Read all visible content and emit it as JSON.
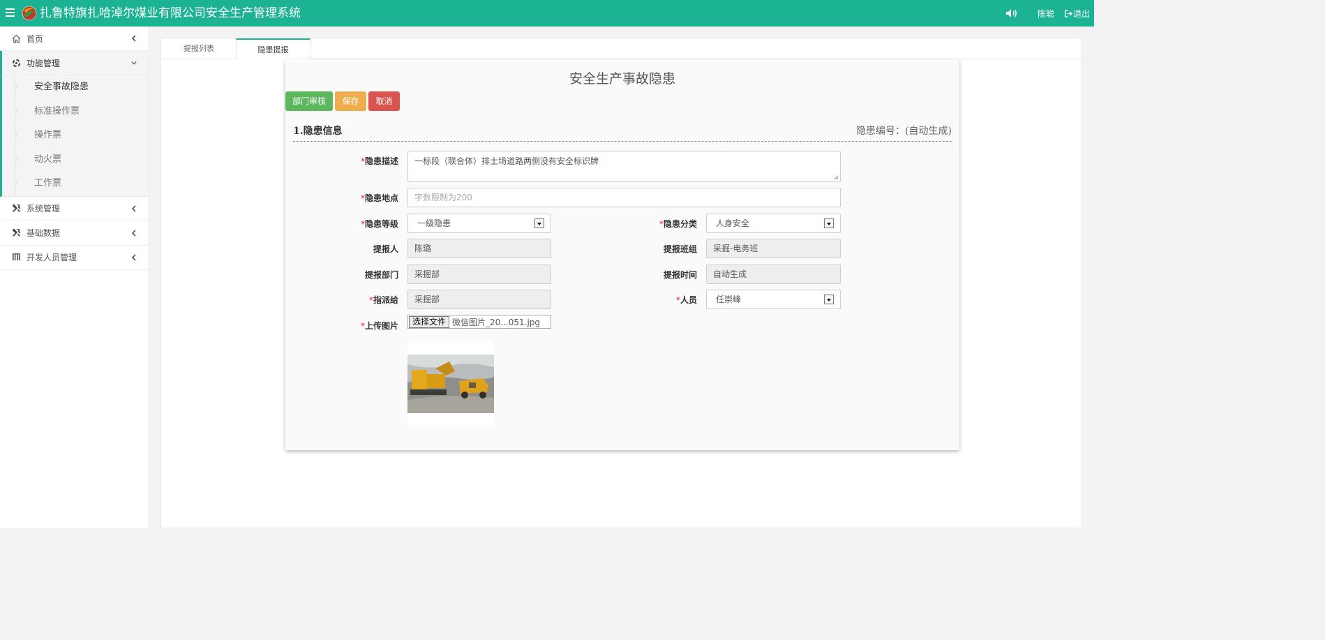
{
  "header": {
    "title": "扎鲁特旗扎哈淖尔煤业有限公司安全生产管理系统",
    "user_name": "陈聪",
    "logout_label": "退出",
    "bg_color": "#1bb394"
  },
  "sidebar": {
    "items": [
      {
        "label": "首页",
        "icon": "home-icon"
      },
      {
        "label": "功能管理",
        "icon": "settings-icon"
      },
      {
        "label": "系统管理",
        "icon": "tools-icon"
      },
      {
        "label": "基础数据",
        "icon": "tools-icon"
      },
      {
        "label": "开发人员管理",
        "icon": "bars-icon"
      }
    ],
    "submenu": [
      {
        "label": "安全事故隐患"
      },
      {
        "label": "标准操作票"
      },
      {
        "label": "操作票"
      },
      {
        "label": "动火票"
      },
      {
        "label": "工作票"
      }
    ]
  },
  "tabs": [
    {
      "label": "提报列表"
    },
    {
      "label": "隐患提报"
    }
  ],
  "form": {
    "title": "安全生产事故隐患",
    "buttons": {
      "review": "部门审核",
      "save": "保存",
      "cancel": "取消"
    },
    "section_title": "1.隐患信息",
    "code_label": "隐患编号：(自动生成)",
    "required_mark": "*",
    "description": {
      "label": "隐患描述",
      "value": "一标段（联合体）排土场道路两侧没有安全标识牌"
    },
    "location": {
      "label": "隐患地点",
      "placeholder": "字数限制为200"
    },
    "level": {
      "label": "隐患等级",
      "value": "一级隐患"
    },
    "category": {
      "label": "隐患分类",
      "value": "人身安全"
    },
    "reporter": {
      "label": "提报人",
      "value": "陈璐"
    },
    "team": {
      "label": "提报班组",
      "value": "采掘-电务班"
    },
    "department": {
      "label": "提报部门",
      "value": "采掘部"
    },
    "report_time": {
      "label": "提报时间",
      "value": "自动生成"
    },
    "assign_to": {
      "label": "指派给",
      "value": "采掘部"
    },
    "person": {
      "label": "人员",
      "value": "任崇峰"
    },
    "upload": {
      "label": "上传图片",
      "button": "选择文件",
      "file_name": "微信图片_20...051.jpg"
    }
  }
}
